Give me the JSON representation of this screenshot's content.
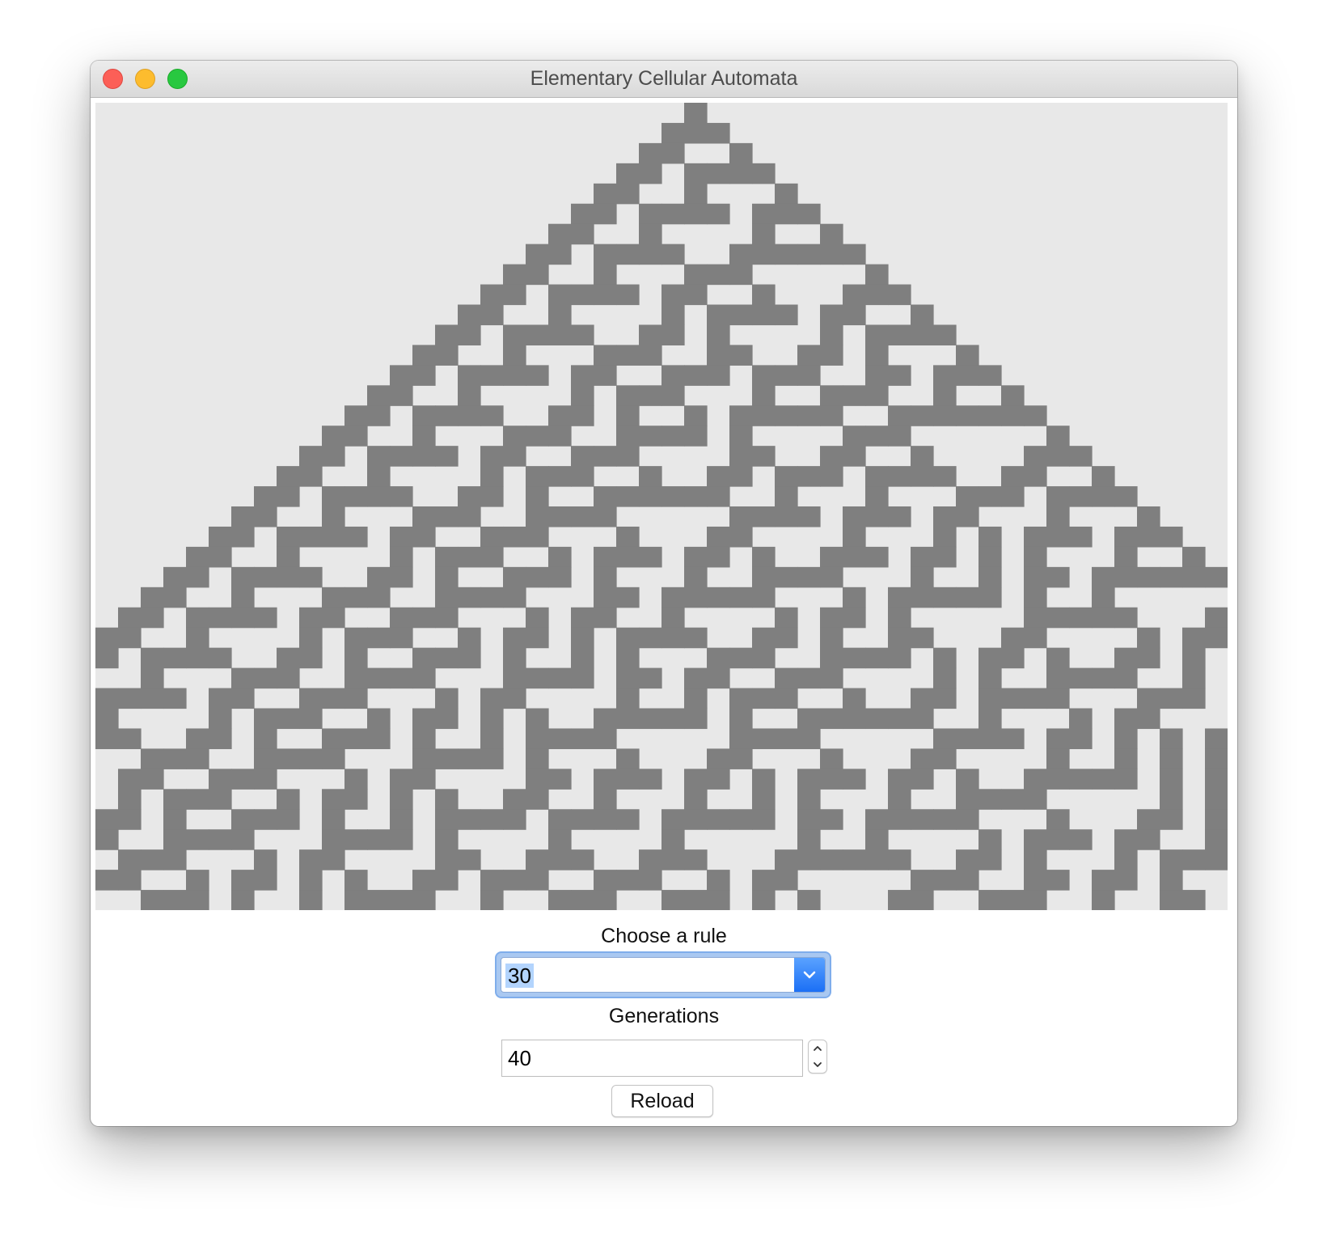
{
  "window": {
    "title": "Elementary Cellular Automata"
  },
  "automaton": {
    "rule": 30,
    "generations": 40,
    "visible_columns": 50,
    "cell_color": "#7f7f7f",
    "background_color": "#e8e8e8"
  },
  "controls": {
    "rule_label": "Choose a rule",
    "rule_value": "30",
    "generations_label": "Generations",
    "generations_value": "40",
    "reload_label": "Reload",
    "accent_color": "#2f80f7"
  },
  "icons": {
    "close": "close-icon",
    "minimize": "minimize-icon",
    "zoom": "zoom-icon",
    "dropdown": "chevron-down-icon",
    "increment": "chevron-up-icon",
    "decrement": "chevron-down-icon"
  }
}
